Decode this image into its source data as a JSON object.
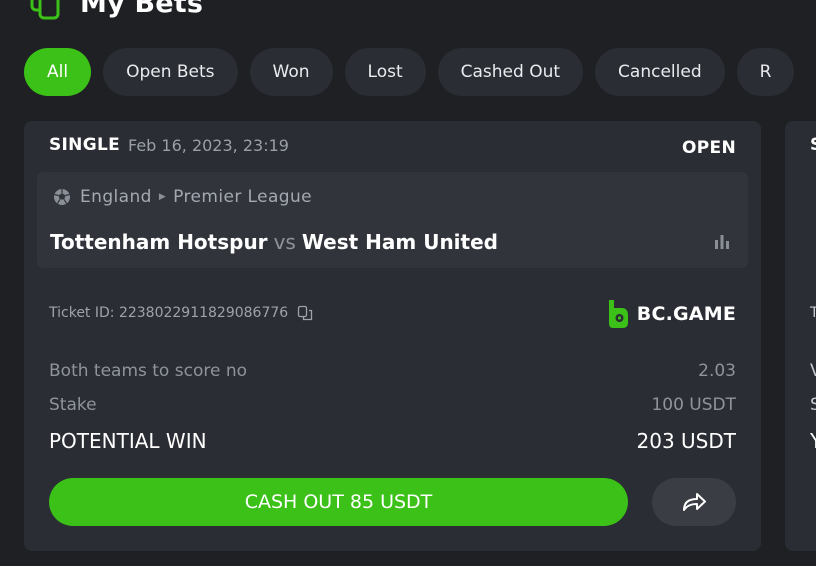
{
  "header": {
    "title": "My Bets"
  },
  "filters": [
    "All",
    "Open Bets",
    "Won",
    "Lost",
    "Cashed Out",
    "Cancelled",
    "R"
  ],
  "bet": {
    "type": "SINGLE",
    "date": "Feb 16, 2023, 23:19",
    "status": "OPEN",
    "country": "England",
    "league": "Premier League",
    "home_team": "Tottenham Hotspur",
    "vs": "vs",
    "away_team": "West Ham United",
    "ticket_label": "Ticket ID:",
    "ticket_id": "2238022911829086776",
    "brand": "BC.GAME",
    "market": "Both teams to score no",
    "odds": "2.03",
    "stake_label": "Stake",
    "stake": "100 USDT",
    "potential_label": "POTENTIAL WIN",
    "potential": "203 USDT",
    "cashout_label": "CASH OUT 85 USDT"
  },
  "next_card": {
    "type": "S",
    "line1": "T",
    "line2": "V",
    "line3": "S",
    "line4": "Y"
  },
  "colors": {
    "accent": "#3bc117",
    "background": "#1e2024",
    "card": "#2a2d33"
  },
  "icons": [
    "bets-logo-icon",
    "soccer-ball-icon",
    "chevron-right-icon",
    "stats-icon",
    "copy-icon",
    "bc-game-logo-icon",
    "share-icon"
  ]
}
